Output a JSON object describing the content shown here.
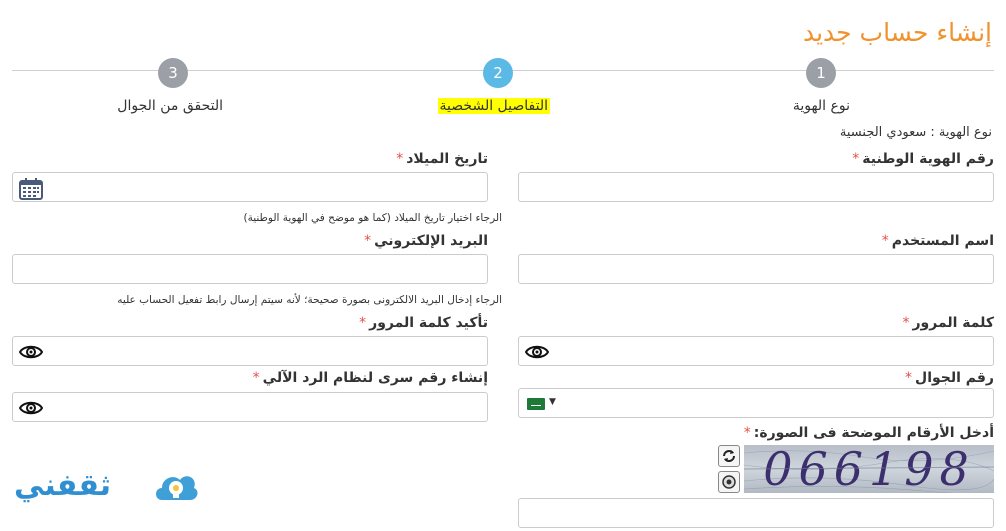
{
  "page_title": "إنشاء حساب جديد",
  "steps": [
    {
      "number": "1",
      "label": "نوع الهوية"
    },
    {
      "number": "2",
      "label": "التفاصيل الشخصية"
    },
    {
      "number": "3",
      "label": "التحقق من الجوال"
    }
  ],
  "id_type_text": "نوع الهوية : سعودي الجنسية",
  "required_mark": "*",
  "fields": {
    "national_id": {
      "label": "رقم الهوية الوطنية",
      "value": ""
    },
    "birth_date": {
      "label": "تاريخ الميلاد",
      "value": "",
      "hint": "الرجاء اختيار تاريخ الميلاد (كما هو موضح في الهوية الوطنية)"
    },
    "username": {
      "label": "اسم المستخدم",
      "value": ""
    },
    "email": {
      "label": "البريد الإلكتروني",
      "value": "",
      "hint": "الرجاء إدخال البريد الالكترونى بصورة صحيحة؛ لأنه سيتم إرسال رابط تفعيل الحساب عليه"
    },
    "password": {
      "label": "كلمة المرور",
      "value": ""
    },
    "confirm_password": {
      "label": "تأكيد كلمة المرور",
      "value": ""
    },
    "mobile": {
      "label": "رقم الجوال",
      "value": ""
    },
    "ivr_pin": {
      "label": "إنشاء رقم سرى لنظام الرد الآلي",
      "value": ""
    },
    "captcha": {
      "label": "أدخل الأرقام الموضحة فى الصورة:",
      "value": "",
      "image_text": "066198"
    }
  },
  "logo_text": "ثقفني",
  "colors": {
    "title": "#f0922e",
    "active_step": "#5bb9e6",
    "inactive_step": "#9aa0a6",
    "required": "#e0534a",
    "highlight": "#ffff00"
  }
}
